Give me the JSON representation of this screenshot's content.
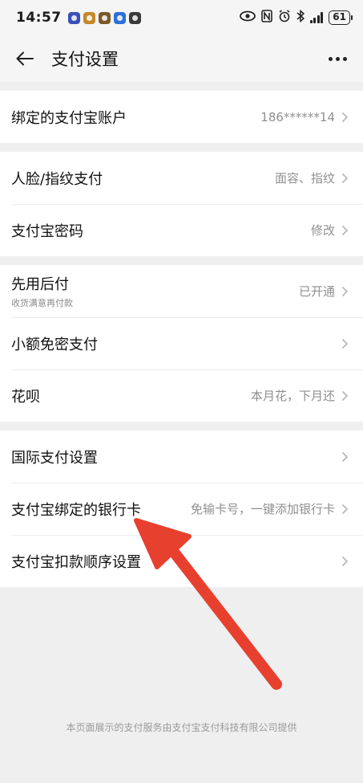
{
  "status_bar": {
    "time": "14:57",
    "battery": "61",
    "app_icon_colors": [
      "#3b4fb8",
      "#c6892a",
      "#7a5a2a",
      "#2f6fd6",
      "#3a3a3a"
    ]
  },
  "nav": {
    "title": "支付设置"
  },
  "groups": [
    {
      "rows": [
        {
          "label": "绑定的支付宝账户",
          "value": "186******14"
        }
      ]
    },
    {
      "rows": [
        {
          "label": "人脸/指纹支付",
          "value": "面容、指纹"
        },
        {
          "label": "支付宝密码",
          "value": "修改"
        }
      ]
    },
    {
      "rows": [
        {
          "label": "先用后付",
          "sub": "收货满意再付款",
          "value": "已开通"
        },
        {
          "label": "小额免密支付",
          "value": ""
        },
        {
          "label": "花呗",
          "value": "本月花，下月还"
        }
      ]
    },
    {
      "rows": [
        {
          "label": "国际支付设置",
          "value": ""
        },
        {
          "label": "支付宝绑定的银行卡",
          "value": "免输卡号，一键添加银行卡"
        },
        {
          "label": "支付宝扣款顺序设置",
          "value": ""
        }
      ]
    }
  ],
  "footer": {
    "text": "本页面展示的支付服务由支付宝支付科技有限公司提供"
  },
  "colors": {
    "annotation_arrow": "#e8402f"
  }
}
